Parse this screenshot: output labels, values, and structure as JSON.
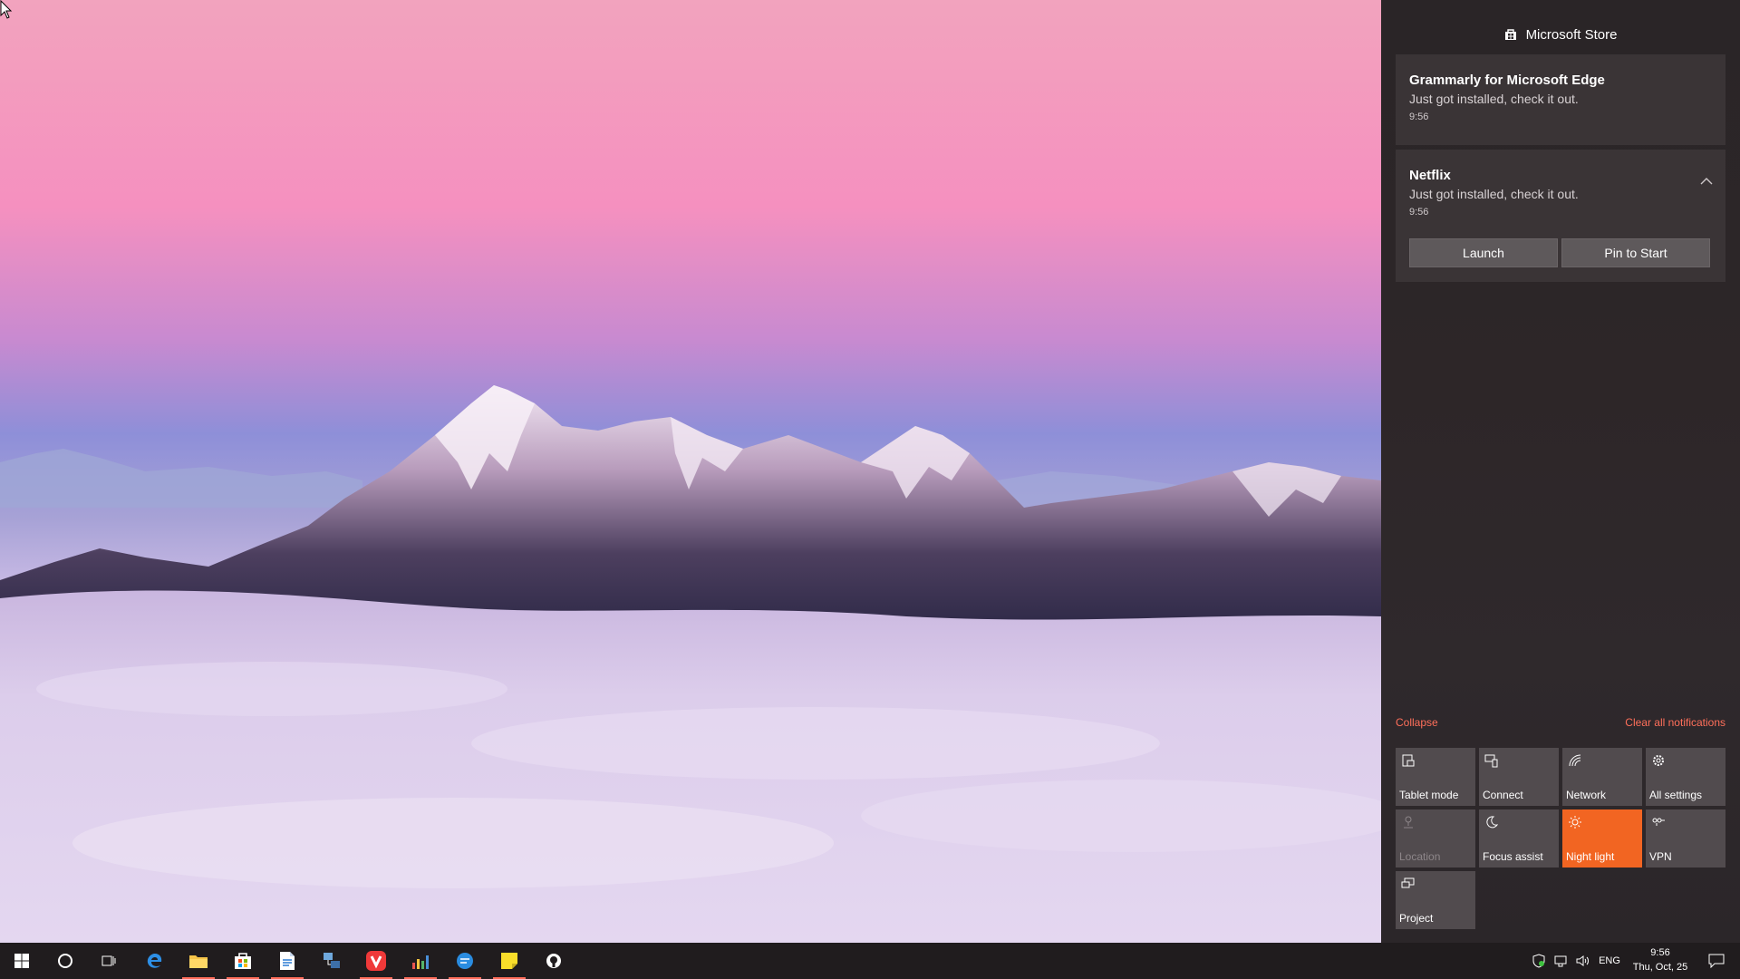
{
  "action_center": {
    "header_title": "Microsoft Store",
    "notifications": [
      {
        "title": "Grammarly for Microsoft Edge",
        "body": "Just got installed, check it out.",
        "time": "9:56"
      },
      {
        "title": "Netflix",
        "body": "Just got installed, check it out.",
        "time": "9:56",
        "buttons": [
          "Launch",
          "Pin to Start"
        ]
      }
    ],
    "collapse_label": "Collapse",
    "clear_all_label": "Clear all notifications",
    "quick_actions": [
      {
        "label": "Tablet mode",
        "icon": "tablet-mode-icon",
        "state": "off"
      },
      {
        "label": "Connect",
        "icon": "connect-icon",
        "state": "off"
      },
      {
        "label": "Network",
        "icon": "network-icon",
        "state": "off"
      },
      {
        "label": "All settings",
        "icon": "gear-icon",
        "state": "off"
      },
      {
        "label": "Location",
        "icon": "location-icon",
        "state": "disabled"
      },
      {
        "label": "Focus assist",
        "icon": "moon-icon",
        "state": "off"
      },
      {
        "label": "Night light",
        "icon": "sun-icon",
        "state": "on"
      },
      {
        "label": "VPN",
        "icon": "vpn-icon",
        "state": "off"
      },
      {
        "label": "Project",
        "icon": "project-icon",
        "state": "off"
      }
    ],
    "accent_color": "#f26522",
    "link_color": "#ff6f5a"
  },
  "taskbar": {
    "language": "ENG",
    "time": "9:56",
    "date": "Thu, Oct, 25",
    "pinned": [
      "start-icon",
      "cortana-icon",
      "task-view-icon",
      "edge-icon",
      "file-explorer-icon",
      "store-icon",
      "document-icon",
      "network-app-icon",
      "vivaldi-icon",
      "chart-app-icon",
      "chat-app-icon",
      "sticky-notes-icon",
      "github-icon"
    ]
  }
}
